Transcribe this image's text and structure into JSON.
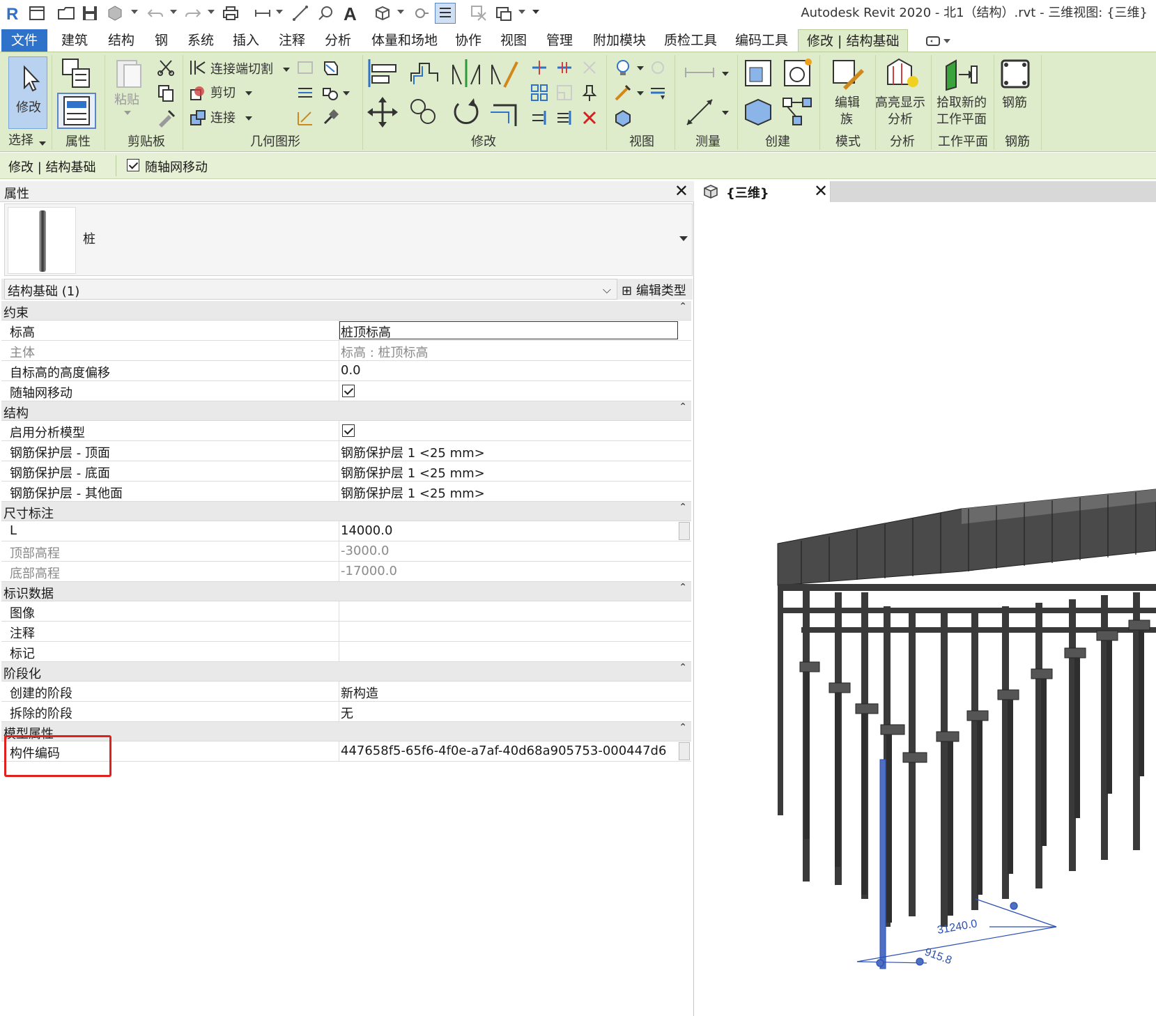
{
  "app": {
    "title": "Autodesk Revit 2020 - 北1（结构）.rvt - 三维视图: {三维}"
  },
  "quick_access": [
    "revit-logo-icon",
    "open-icon",
    "folder-icon",
    "save-icon",
    "sync-icon",
    "undo-icon",
    "redo-icon",
    "print-icon",
    "measure-icon",
    "dimension-icon",
    "tag-icon",
    "text-icon",
    "3d-view-icon",
    "section-icon",
    "thin-lines-icon",
    "close-hidden-icon",
    "switch-windows-icon",
    "customize-icon"
  ],
  "menu": {
    "file": "文件",
    "tabs": [
      "建筑",
      "结构",
      "钢",
      "系统",
      "插入",
      "注释",
      "分析",
      "体量和场地",
      "协作",
      "视图",
      "管理",
      "附加模块",
      "质检工具",
      "编码工具"
    ],
    "active": "修改 | 结构基础"
  },
  "ribbon": {
    "modify": "修改",
    "select": "选择",
    "properties": "属性",
    "paste": "粘贴",
    "clipboard": "剪贴板",
    "cut_join": "连接端切割",
    "cut": "剪切",
    "join": "连接",
    "geometry": "几何图形",
    "modify_group": "修改",
    "view_group": "视图",
    "measure_group": "测量",
    "create_group": "创建",
    "edit_family": "编辑",
    "edit_family_2": "族",
    "mode_group": "模式",
    "highlight": "高亮显示",
    "highlight_2": "分析",
    "analysis_group": "分析",
    "pick_plane": "拾取新的",
    "pick_plane_2": "工作平面",
    "workplane_group": "工作平面",
    "rebar": "钢筋",
    "rebar_group": "钢筋"
  },
  "options_bar": {
    "context": "修改 | 结构基础",
    "move_with_grids": "随轴网移动"
  },
  "properties": {
    "title": "属性",
    "type_name": "桩",
    "instance": "结构基础 (1)",
    "edit_type": "编辑类型",
    "categories": [
      {
        "name": "约束",
        "rows": [
          {
            "name": "标高",
            "value": "桩顶标高"
          },
          {
            "name": "主体",
            "value": "标高 : 桩顶标高"
          },
          {
            "name": "自标高的高度偏移",
            "value": "0.0"
          },
          {
            "name": "随轴网移动",
            "value": ""
          }
        ]
      },
      {
        "name": "结构",
        "rows": [
          {
            "name": "启用分析模型",
            "value": ""
          },
          {
            "name": "钢筋保护层 - 顶面",
            "value": "钢筋保护层 1 <25 mm>"
          },
          {
            "name": "钢筋保护层 - 底面",
            "value": "钢筋保护层 1 <25 mm>"
          },
          {
            "name": "钢筋保护层 - 其他面",
            "value": "钢筋保护层 1 <25 mm>"
          }
        ]
      },
      {
        "name": "尺寸标注",
        "rows": [
          {
            "name": "L",
            "value": "14000.0"
          },
          {
            "name": "顶部高程",
            "value": "-3000.0"
          },
          {
            "name": "底部高程",
            "value": "-17000.0"
          }
        ]
      },
      {
        "name": "标识数据",
        "rows": [
          {
            "name": "图像",
            "value": ""
          },
          {
            "name": "注释",
            "value": ""
          },
          {
            "name": "标记",
            "value": ""
          }
        ]
      },
      {
        "name": "阶段化",
        "rows": [
          {
            "name": "创建的阶段",
            "value": "新构造"
          },
          {
            "name": "拆除的阶段",
            "value": "无"
          }
        ]
      },
      {
        "name": "模型属性",
        "rows": [
          {
            "name": "构件编码",
            "value": "447658f5-65f6-4f0e-a7af-40d68a905753-000447d6"
          }
        ]
      }
    ]
  },
  "view": {
    "tab_title": "{三维}",
    "dim_1": "31240.0",
    "dim_2": "915.8"
  },
  "colors": {
    "file_tab": "#2f72c9",
    "ribbon_bg": "#dfeccb",
    "highlight_box": "#e0201c",
    "selected_pile": "#4e6fc2",
    "dimension": "#2a4fb5"
  }
}
